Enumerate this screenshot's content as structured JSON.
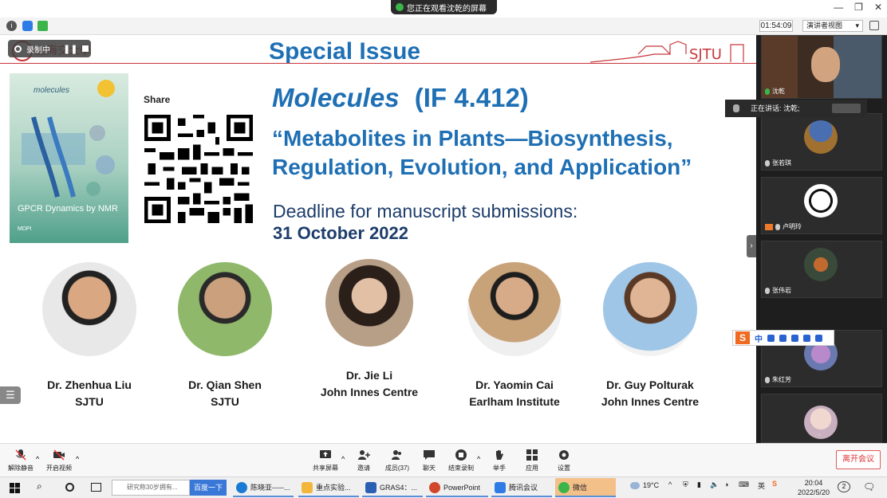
{
  "titlebar": {
    "share_banner": "您正在观看沈乾的屏幕",
    "controls": [
      "—",
      "❐",
      "✕"
    ]
  },
  "toolbar": {
    "timer": "01:54:09",
    "view_mode": "演讲者视图"
  },
  "slide": {
    "recording_label": "录制中",
    "title": "Special Issue",
    "journal": "Molecules",
    "impact": "(IF 4.412)",
    "issue_line1": "“Metabolites in Plants—Biosynthesis,",
    "issue_line2": "Regulation, Evolution, and Application”",
    "deadline_label": "Deadline for manuscript submissions:",
    "deadline_date": "31 October 2022",
    "share_label": "Share",
    "cover_name": "molecules",
    "cover_title": "GPCR Dynamics by NMR",
    "cover_publisher": "MDPI",
    "people": [
      {
        "name": "Dr. Zhenhua Liu",
        "affiliation": "SJTU"
      },
      {
        "name": "Dr. Qian Shen",
        "affiliation": "SJTU"
      },
      {
        "name": "Dr. Jie Li",
        "affiliation": "John Innes Centre"
      },
      {
        "name": "Dr. Yaomin Cai",
        "affiliation": "Earlham Institute"
      },
      {
        "name": "Dr. Guy Polturak",
        "affiliation": "John Innes Centre"
      }
    ]
  },
  "panel": {
    "speaker_name": "沈乾",
    "speaking_label": "正在讲话: 沈乾;",
    "participants": [
      "张若琪",
      "卢明玲",
      "张伟岩",
      "朱红芳"
    ]
  },
  "ime": {
    "lang": "中"
  },
  "meeting_bar": {
    "unmute": "解除静音",
    "video": "开启视频",
    "share_screen": "共享屏幕",
    "invite": "邀请",
    "members": "成员(37)",
    "chat": "聊天",
    "stop_record": "结束录制",
    "raise_hand": "举手",
    "apps": "应用",
    "settings": "设置",
    "leave": "离开会议"
  },
  "taskbar": {
    "search_placeholder": "研究称30岁拥有...",
    "search_button": "百度一下",
    "apps": [
      {
        "label": "陈晓亚-----...",
        "color": "#1b7bd4"
      },
      {
        "label": "重点实验...",
        "color": "#f2b73a"
      },
      {
        "label": "GRAS4：...",
        "color": "#2b5fb4"
      },
      {
        "label": "PowerPoint",
        "color": "#d2472c"
      },
      {
        "label": "腾讯会议",
        "color": "#2e7be6"
      },
      {
        "label": "微信",
        "color": "#3bb54a"
      }
    ],
    "weather": "19°C",
    "time": "20:04",
    "date": "2022/5/20",
    "notify_count": "2"
  },
  "colors": {
    "accent_blue": "#1e6fb4",
    "dark_blue": "#1d3d6b",
    "panel_bg": "#1e1e1e"
  }
}
